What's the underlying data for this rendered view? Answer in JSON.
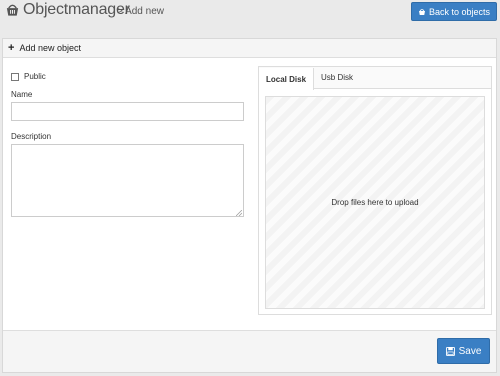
{
  "header": {
    "app_title": "Objectmanager",
    "breadcrumb": "> Add new",
    "back_button_label": "Back to objects",
    "back_button_icon": "basket-icon",
    "app_icon": "basket-icon"
  },
  "panel": {
    "title": "Add new object",
    "title_icon": "plus-icon"
  },
  "form": {
    "public_label": "Public",
    "public_checked": false,
    "name_label": "Name",
    "name_value": "",
    "description_label": "Description",
    "description_value": ""
  },
  "upload": {
    "tabs": [
      {
        "label": "Local Disk",
        "active": true
      },
      {
        "label": "Usb Disk",
        "active": false
      }
    ],
    "dropzone_text": "Drop files here to upload"
  },
  "footer": {
    "save_label": "Save",
    "save_icon": "floppy-disk-icon"
  },
  "colors": {
    "accent": "#3a7fc4",
    "background": "#eaeaea"
  }
}
